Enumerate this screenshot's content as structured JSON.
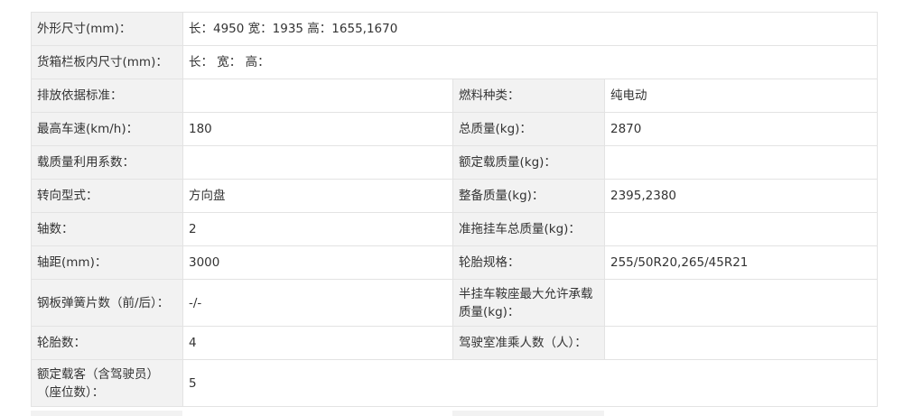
{
  "specs": {
    "dimensions": {
      "label": "外形尺寸(mm)：",
      "value": "长：4950 宽：1935 高：1655,1670"
    },
    "cargo_box": {
      "label": "货箱栏板内尺寸(mm)：",
      "value": "长： 宽： 高："
    },
    "emission_standard": {
      "label": "排放依据标准：",
      "value": ""
    },
    "fuel_type": {
      "label": "燃料种类：",
      "value": "纯电动"
    },
    "max_speed": {
      "label": "最高车速(km/h)：",
      "value": "180"
    },
    "total_mass": {
      "label": "总质量(kg)：",
      "value": "2870"
    },
    "load_utilization": {
      "label": "载质量利用系数：",
      "value": ""
    },
    "rated_load": {
      "label": "额定载质量(kg)：",
      "value": ""
    },
    "steering": {
      "label": "转向型式：",
      "value": "方向盘"
    },
    "curb_weight": {
      "label": "整备质量(kg)：",
      "value": "2395,2380"
    },
    "axles": {
      "label": "轴数：",
      "value": "2"
    },
    "trailer_mass": {
      "label": "准拖挂车总质量(kg)：",
      "value": ""
    },
    "wheelbase": {
      "label": "轴距(mm)：",
      "value": "3000"
    },
    "tire_spec": {
      "label": "轮胎规格：",
      "value": "255/50R20,265/45R21"
    },
    "leaf_springs": {
      "label": "钢板弹簧片数（前/后）：",
      "value": "-/-"
    },
    "saddle_load": {
      "label": "半挂车鞍座最大允许承载质量(kg)：",
      "value": ""
    },
    "tire_count": {
      "label": "轮胎数：",
      "value": "4"
    },
    "cab_occupants": {
      "label": "驾驶室准乘人数（人）：",
      "value": ""
    },
    "seats": {
      "label": "额定载客（含驾驶员）（座位数）：",
      "value": "5"
    }
  }
}
